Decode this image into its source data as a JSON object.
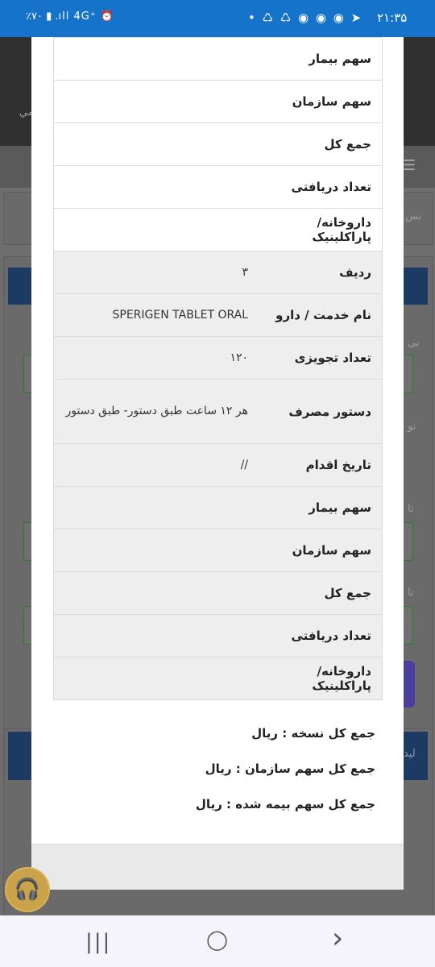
{
  "status_bar": {
    "time": "۲۱:۳۵",
    "left_indicators": "٪۷۰ ▮ .ıll 4G⁺ ⏰",
    "right_indicators": "• ♺ ♺ ◉ ◉ ◉ ➤"
  },
  "background": {
    "header_text": "مي",
    "strip_text": "نس",
    "label_1": "بي",
    "label_2": "نو",
    "label_3": "تا",
    "label_4": "تا",
    "label_5": "ليد"
  },
  "modal": {
    "table_rows": [
      {
        "key": "سهم بیمار",
        "value": "",
        "shade": "white",
        "height": 53
      },
      {
        "key": "سهم سازمان",
        "value": "",
        "shade": "white",
        "height": 53
      },
      {
        "key": "جمع کل",
        "value": "",
        "shade": "white",
        "height": 53
      },
      {
        "key": "تعداد دریافتی",
        "value": "",
        "shade": "white",
        "height": 53
      },
      {
        "key": "داروخانه/پاراکلینیک",
        "value": "",
        "shade": "white",
        "height": 53
      },
      {
        "key": "ردیف",
        "value": "۳",
        "shade": "gray",
        "height": 53
      },
      {
        "key": "نام خدمت / دارو",
        "value": "SPERIGEN TABLET ORAL",
        "shade": "gray",
        "height": 53
      },
      {
        "key": "تعداد تجویزی",
        "value": "۱۲۰",
        "shade": "gray",
        "height": 53
      },
      {
        "key": "دستور مصرف",
        "value": "هر ۱۲ ساعت طبق دستور- طبق دستور",
        "shade": "gray",
        "height": 80
      },
      {
        "key": "تاریخ اقدام",
        "value": "//",
        "shade": "gray",
        "height": 53
      },
      {
        "key": "سهم بیمار",
        "value": "",
        "shade": "gray",
        "height": 53
      },
      {
        "key": "سهم سازمان",
        "value": "",
        "shade": "gray",
        "height": 53
      },
      {
        "key": "جمع کل",
        "value": "",
        "shade": "gray",
        "height": 53
      },
      {
        "key": "تعداد دریافتی",
        "value": "",
        "shade": "gray",
        "height": 53
      },
      {
        "key": "داروخانه/پاراکلینیک",
        "value": "",
        "shade": "gray",
        "height": 53
      }
    ],
    "sum_total": "جمع کل نسخه : ریال",
    "sum_org": "جمع کل سهم سازمان : ریال",
    "sum_insured": "جمع کل سهم بیمه شده : ریال"
  },
  "nav": {
    "recents": "|||",
    "home": "◯",
    "back": "›"
  },
  "assistant_icon": "headset-icon"
}
